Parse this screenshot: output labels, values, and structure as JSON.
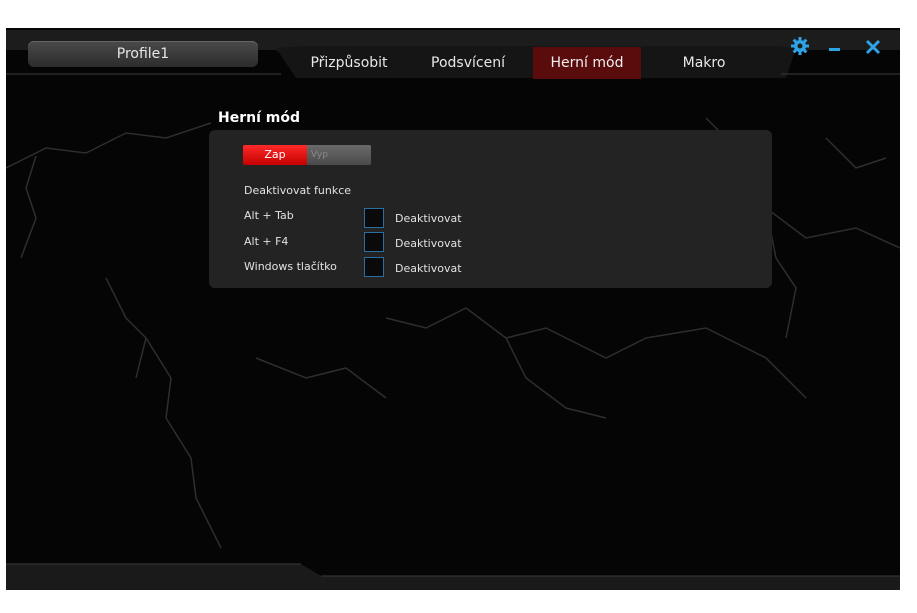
{
  "profile": {
    "label": "Profile1"
  },
  "tabs": [
    {
      "label": "Přizpůsobit"
    },
    {
      "label": "Podsvícení"
    },
    {
      "label": "Herní mód",
      "active": true
    },
    {
      "label": "Makro"
    }
  ],
  "window_buttons": {
    "settings": "gear-icon",
    "minimize": "minimize-icon",
    "close": "close-icon"
  },
  "game_mode": {
    "title": "Herní mód",
    "toggle": {
      "on_label": "Zap",
      "off_label": "Vyp",
      "state": "on"
    },
    "deactivate_heading": "Deaktivovat funkce",
    "rows": [
      {
        "label": "Alt + Tab",
        "checkbox_label": "Deaktivovat",
        "checked": false
      },
      {
        "label": "Alt + F4",
        "checkbox_label": "Deaktivovat",
        "checked": false
      },
      {
        "label": "Windows tlačítko",
        "checkbox_label": "Deaktivovat",
        "checked": false
      }
    ]
  },
  "colors": {
    "accent_blue": "#2fa3e6",
    "active_tab": "#5a0b0b",
    "toggle_on": "#e00000",
    "panel": "#232323"
  }
}
